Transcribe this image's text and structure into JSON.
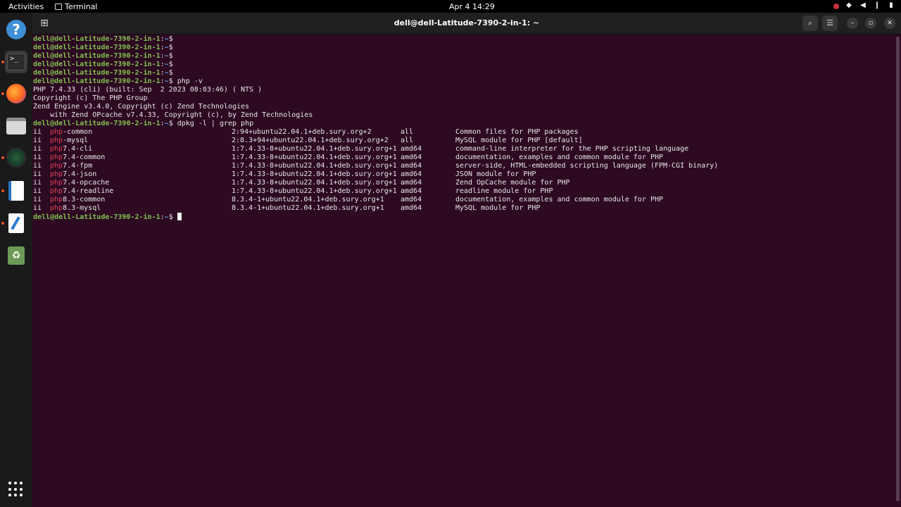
{
  "topbar": {
    "activities": "Activities",
    "app_name": "Terminal",
    "clock": "Apr 4  14:29"
  },
  "window": {
    "title": "dell@dell-Latitude-7390-2-in-1: ~"
  },
  "prompt": {
    "user_host": "dell@dell-Latitude-7390-2-in-1",
    "path": "~",
    "symbol": "$"
  },
  "terminal": {
    "empty_prompts": 5,
    "cmd1": "php -v",
    "php_output": [
      "PHP 7.4.33 (cli) (built: Sep  2 2023 08:03:46) ( NTS )",
      "Copyright (c) The PHP Group",
      "Zend Engine v3.4.0, Copyright (c) Zend Technologies",
      "    with Zend OPcache v7.4.33, Copyright (c), by Zend Technologies"
    ],
    "cmd2": "dpkg -l | grep php",
    "packages": [
      {
        "status": "ii",
        "prefix": "php",
        "name_rest": "-common",
        "version": "2:94+ubuntu22.04.1+deb.sury.org+2",
        "arch": "all",
        "desc": "Common files for PHP packages"
      },
      {
        "status": "ii",
        "prefix": "php",
        "name_rest": "-mysql",
        "version": "2:8.3+94+ubuntu22.04.1+deb.sury.org+2",
        "arch": "all",
        "desc": "MySQL module for PHP [default]"
      },
      {
        "status": "ii",
        "prefix": "php",
        "name_rest": "7.4-cli",
        "version": "1:7.4.33-8+ubuntu22.04.1+deb.sury.org+1",
        "arch": "amd64",
        "desc": "command-line interpreter for the PHP scripting language"
      },
      {
        "status": "ii",
        "prefix": "php",
        "name_rest": "7.4-common",
        "version": "1:7.4.33-8+ubuntu22.04.1+deb.sury.org+1",
        "arch": "amd64",
        "desc": "documentation, examples and common module for PHP"
      },
      {
        "status": "ii",
        "prefix": "php",
        "name_rest": "7.4-fpm",
        "version": "1:7.4.33-8+ubuntu22.04.1+deb.sury.org+1",
        "arch": "amd64",
        "desc": "server-side, HTML-embedded scripting language (FPM-CGI binary)"
      },
      {
        "status": "ii",
        "prefix": "php",
        "name_rest": "7.4-json",
        "version": "1:7.4.33-8+ubuntu22.04.1+deb.sury.org+1",
        "arch": "amd64",
        "desc": "JSON module for PHP"
      },
      {
        "status": "ii",
        "prefix": "php",
        "name_rest": "7.4-opcache",
        "version": "1:7.4.33-8+ubuntu22.04.1+deb.sury.org+1",
        "arch": "amd64",
        "desc": "Zend OpCache module for PHP"
      },
      {
        "status": "ii",
        "prefix": "php",
        "name_rest": "7.4-readline",
        "version": "1:7.4.33-8+ubuntu22.04.1+deb.sury.org+1",
        "arch": "amd64",
        "desc": "readline module for PHP"
      },
      {
        "status": "ii",
        "prefix": "php",
        "name_rest": "8.3-common",
        "version": "8.3.4-1+ubuntu22.04.1+deb.sury.org+1",
        "arch": "amd64",
        "desc": "documentation, examples and common module for PHP"
      },
      {
        "status": "ii",
        "prefix": "php",
        "name_rest": "8.3-mysql",
        "version": "8.3.4-1+ubuntu22.04.1+deb.sury.org+1",
        "arch": "amd64",
        "desc": "MySQL module for PHP"
      }
    ]
  },
  "dock": {
    "items": [
      "help-icon",
      "terminal-icon",
      "firefox-icon",
      "files-icon",
      "globe-icon",
      "writer-icon",
      "text-editor-icon",
      "trash-icon",
      "app-grid-icon"
    ]
  },
  "colors": {
    "terminal_bg": "#2d0922",
    "prompt_user": "#80c04f",
    "prompt_path": "#6aa0e0",
    "grep_highlight": "#e0405a",
    "accent": "#e95420"
  }
}
